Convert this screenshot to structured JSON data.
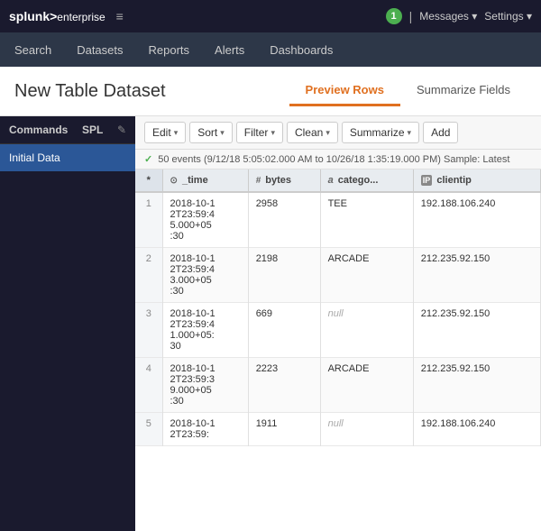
{
  "topnav": {
    "logo_text": "splunk>",
    "logo_suffix": "enterprise",
    "nav_icon": "≡",
    "info_badge": "1",
    "pipe_icon": "|",
    "messages_label": "Messages ▾",
    "settings_label": "Settings ▾"
  },
  "secondnav": {
    "items": [
      "Search",
      "Datasets",
      "Reports",
      "Alerts",
      "Dashboards"
    ]
  },
  "header": {
    "title": "New Table Dataset",
    "tabs": [
      "Preview Rows",
      "Summarize Fields"
    ]
  },
  "sidebar": {
    "commands_label": "Commands",
    "spl_label": "SPL",
    "edit_icon": "✎",
    "items": [
      "Initial Data"
    ]
  },
  "toolbar": {
    "buttons": [
      "Edit ▾",
      "Sort ▾",
      "Filter ▾",
      "Clean ▾",
      "Summarize ▾",
      "Add"
    ]
  },
  "status": {
    "check": "✓",
    "text": "50 events (9/12/18 5:05:02.000 AM to 10/26/18 1:35:19.000 PM)  Sample: Latest"
  },
  "table": {
    "columns": [
      {
        "icon": "⊙",
        "name": "_time"
      },
      {
        "icon": "#",
        "name": "bytes"
      },
      {
        "icon": "a",
        "name": "catego..."
      },
      {
        "icon": "IP",
        "name": "clientip"
      }
    ],
    "rows": [
      {
        "num": "1",
        "time": "2018-10-12T23:59:45.000+05:30",
        "bytes": "2958",
        "category": "TEE",
        "clientip": "192.188.106.240"
      },
      {
        "num": "2",
        "time": "2018-10-12T23:59:43.000+05:30",
        "bytes": "2198",
        "category": "ARCADE",
        "clientip": "212.235.92.150"
      },
      {
        "num": "3",
        "time": "2018-10-12T23:59:41.000+05:30",
        "bytes": "669",
        "category": null,
        "clientip": "212.235.92.150"
      },
      {
        "num": "4",
        "time": "2018-10-12T23:59:39.000+05:30",
        "bytes": "2223",
        "category": "ARCADE",
        "clientip": "212.235.92.150"
      },
      {
        "num": "5",
        "time": "2018-10-12T23:59:",
        "bytes": "1911",
        "category": null,
        "clientip": "192.188.106.240"
      }
    ]
  }
}
